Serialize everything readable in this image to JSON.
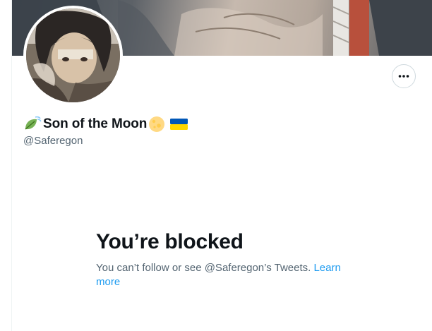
{
  "profile": {
    "display_name": "Son of the Moon",
    "name_prefix_icon": "leaf-fluttering-in-wind-icon",
    "name_suffix_icons": [
      "full-moon-icon",
      "ukraine-flag-icon"
    ],
    "handle": "@Saferegon"
  },
  "header": {
    "more_button_icon": "more-horizontal-icon"
  },
  "blocked": {
    "title": "You’re blocked",
    "description": "You can’t follow or see @Saferegon’s Tweets. ",
    "learn_more_label": "Learn more"
  },
  "colors": {
    "primary_text": "#0f1419",
    "secondary_text": "#536471",
    "link": "#1d9bf0",
    "border": "#cfd9de",
    "flag_blue": "#0057b7",
    "flag_yellow": "#ffd700"
  }
}
